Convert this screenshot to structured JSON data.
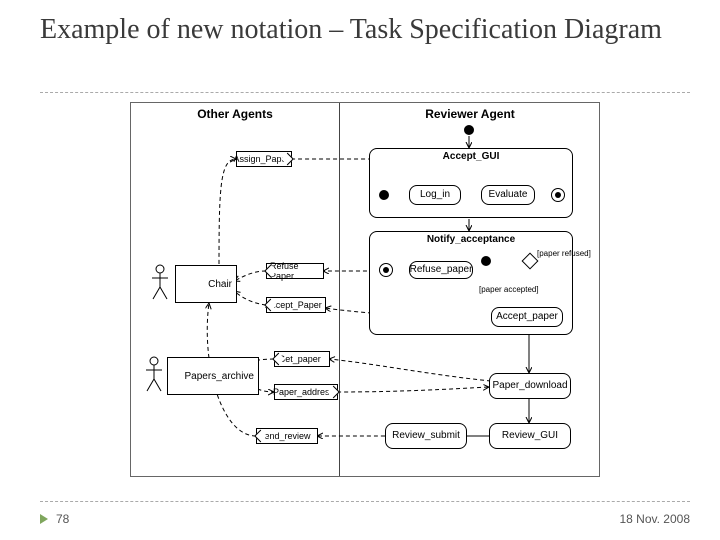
{
  "title": "Example of new notation – Task Specification Diagram",
  "footer": {
    "page": "78",
    "date": "18 Nov. 2008"
  },
  "lanes": {
    "left": "Other Agents",
    "right": "Reviewer Agent"
  },
  "actors": {
    "chair": "Chair",
    "papers_archive": "Papers_archive"
  },
  "msgs": {
    "assign_paper": "Assign_Paper",
    "refuse_paper": "Refuse Paper",
    "accept_paper": "Accept_Paper",
    "get_paper": "Get_paper",
    "paper_address": "Paper_address",
    "send_review": "Send_review"
  },
  "acts": {
    "accept_gui": "Accept_GUI",
    "log_in": "Log_in",
    "evaluate": "Evaluate",
    "notify_acceptance": "Notify_acceptance",
    "refuse_paper": "Refuse_paper",
    "accept_paper": "Accept_paper",
    "paper_download": "Paper_download",
    "review_gui": "Review_GUI",
    "review_submit": "Review_submit"
  },
  "guards": {
    "refused": "[paper refused]",
    "accepted": "[paper accepted]"
  }
}
